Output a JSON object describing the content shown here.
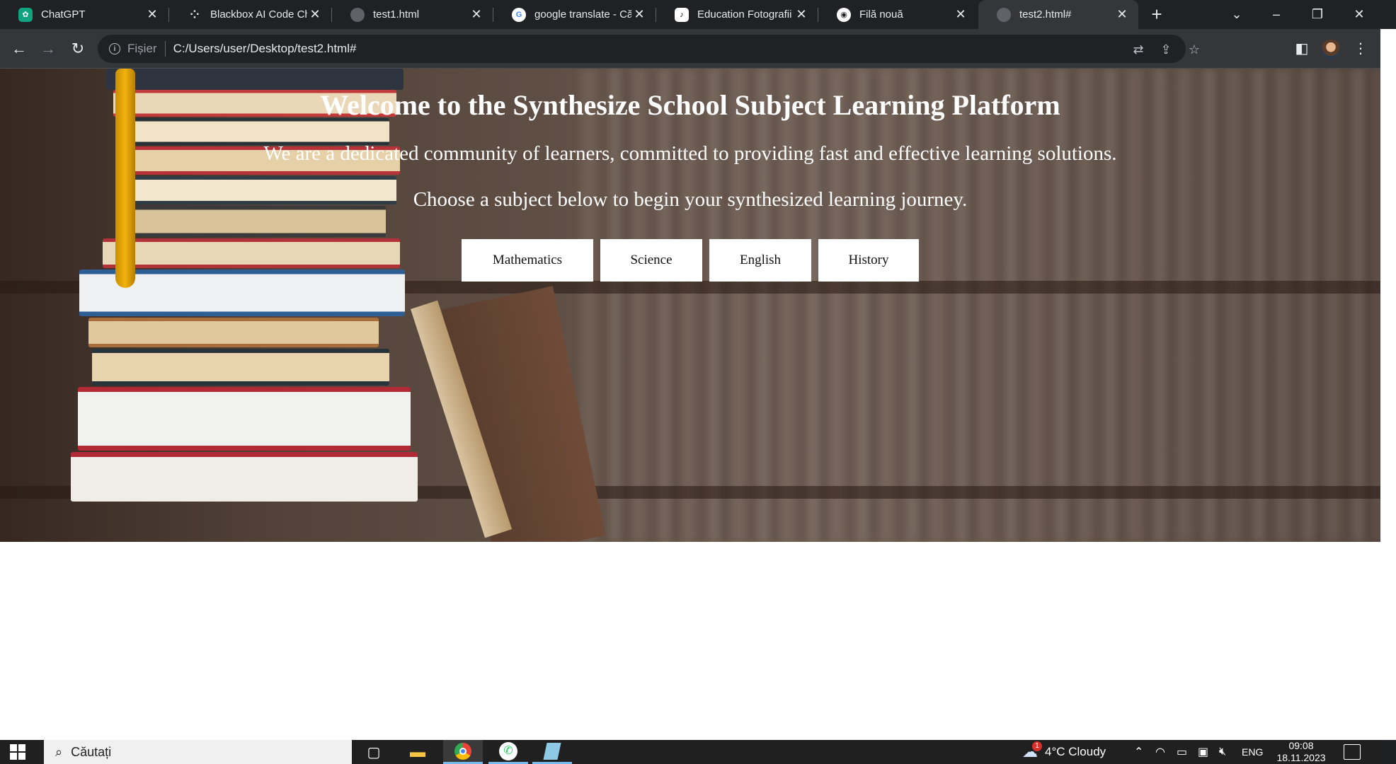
{
  "browser": {
    "tabs": [
      {
        "title": "ChatGPT",
        "favicon": "chatgpt-icon",
        "color": "#10a37f"
      },
      {
        "title": "Blackbox AI Code Ch",
        "favicon": "blackbox-icon",
        "color": "#9aa0a6"
      },
      {
        "title": "test1.html",
        "favicon": "globe-icon",
        "color": "#5f6368"
      },
      {
        "title": "google translate - Că",
        "favicon": "google-icon",
        "color": "#ffffff"
      },
      {
        "title": "Education Fotografii",
        "favicon": "tiktok-icon",
        "color": "#ffffff"
      },
      {
        "title": "Filă nouă",
        "favicon": "chrome-icon",
        "color": "#ffffff"
      },
      {
        "title": "test2.html#",
        "favicon": "globe-icon",
        "color": "#5f6368",
        "active": true
      }
    ],
    "scheme_label": "Fișier",
    "url": "C:/Users/user/Desktop/test2.html#"
  },
  "page": {
    "title": "Welcome to the Synthesize School Subject Learning Platform",
    "subtitle": "We are a dedicated community of learners, committed to providing fast and effective learning solutions.",
    "prompt": "Choose a subject below to begin your synthesized learning journey.",
    "subjects": [
      "Mathematics",
      "Science",
      "English",
      "History"
    ]
  },
  "taskbar": {
    "search_placeholder": "Căutați",
    "weather": "4°C  Cloudy",
    "weather_badge": "1",
    "language": "ENG",
    "time": "09:08",
    "date": "18.11.2023"
  },
  "colors": {
    "tabstrip": "#202124",
    "toolbar": "#35363a",
    "omnibox": "#202124",
    "taskbar": "#202020",
    "accent": "#76b9ed"
  }
}
